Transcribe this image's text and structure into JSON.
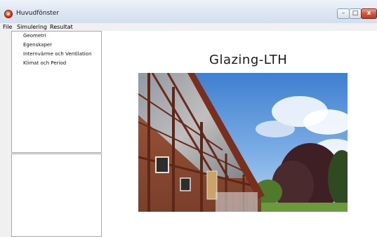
{
  "window": {
    "title": "Huvudfönster",
    "controls": {
      "minimize": "–",
      "maximize": "□",
      "close": "x"
    }
  },
  "menu": {
    "items": [
      {
        "label": "File"
      },
      {
        "label": "Simulering"
      },
      {
        "label": "Resultat"
      }
    ]
  },
  "sidebar": {
    "items": [
      {
        "label": "Geometri"
      },
      {
        "label": "Egenskaper"
      },
      {
        "label": "Internvärme och Ventilation"
      },
      {
        "label": "Klimat och Period"
      }
    ]
  },
  "main": {
    "heading": "Glazing-LTH"
  },
  "colors": {
    "titlebar": "#dfe8f3",
    "close_button": "#d4553d",
    "sky": "#4a86cf"
  }
}
